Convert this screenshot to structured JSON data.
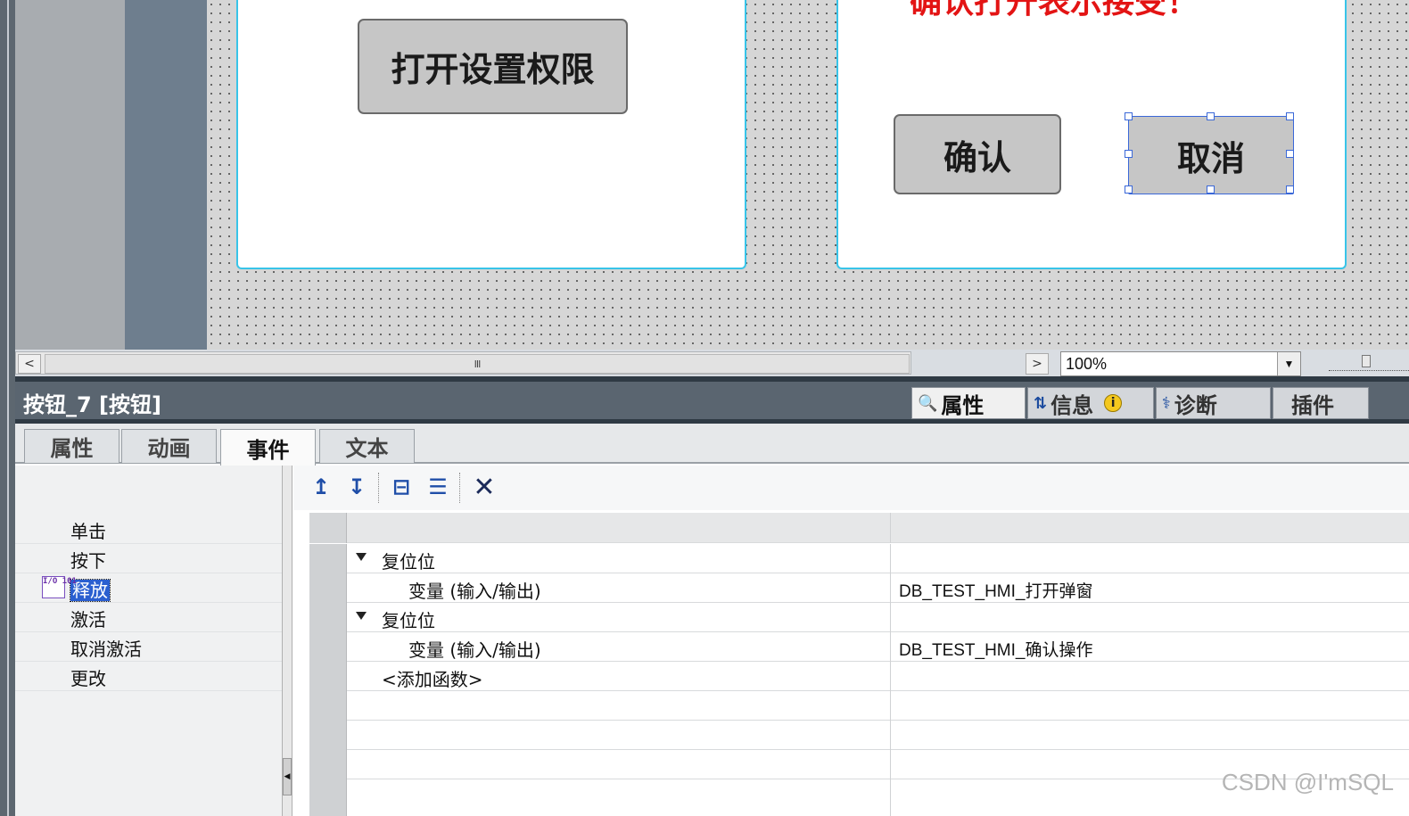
{
  "canvas": {
    "popup_left": {
      "open_permission_button": "打开设置权限"
    },
    "popup_right": {
      "message": "确认打开表示接受！",
      "confirm_button": "确认",
      "cancel_button": "取消"
    }
  },
  "scroll": {
    "left_arrow": "<",
    "right_arrow": ">",
    "thumb_grip": "III",
    "zoom_value": "100%",
    "zoom_dropdown": "▼"
  },
  "inspector": {
    "object_title": "按钮_7 [按钮]",
    "tabs": [
      {
        "label": "属性",
        "icon": "properties-icon"
      },
      {
        "label": "信息",
        "icon": "info-icon"
      },
      {
        "label": "诊断",
        "icon": "diagnostics-icon"
      },
      {
        "label": "插件",
        "icon": ""
      }
    ],
    "info_badge": "i",
    "sub_tabs": [
      "属性",
      "动画",
      "事件",
      "文本"
    ],
    "active_sub_tab": "事件",
    "events": [
      "单击",
      "按下",
      "释放",
      "激活",
      "取消激活",
      "更改"
    ],
    "selected_event": "释放",
    "event_icon_text": "I/O 101",
    "toolbar": [
      {
        "name": "move-up-icon",
        "glyph": "↥"
      },
      {
        "name": "move-down-icon",
        "glyph": "↧"
      },
      {
        "name": "collapse-icon",
        "glyph": "⊟"
      },
      {
        "name": "expand-all-icon",
        "glyph": "☰"
      },
      {
        "name": "delete-icon",
        "glyph": "✕"
      }
    ],
    "functions": [
      {
        "type": "function",
        "name": "复位位"
      },
      {
        "type": "param",
        "name": "变量 (输入/输出)",
        "value": "DB_TEST_HMI_打开弹窗"
      },
      {
        "type": "function",
        "name": "复位位"
      },
      {
        "type": "param",
        "name": "变量 (输入/输出)",
        "value": "DB_TEST_HMI_确认操作"
      },
      {
        "type": "add",
        "name": "<添加函数>"
      }
    ]
  },
  "watermark": "CSDN @I'mSQL",
  "colors": {
    "popup_border": "#38c4e8",
    "message_red": "#e31414",
    "selection_blue": "#2a5fd0",
    "header_bg": "#5a6570"
  }
}
